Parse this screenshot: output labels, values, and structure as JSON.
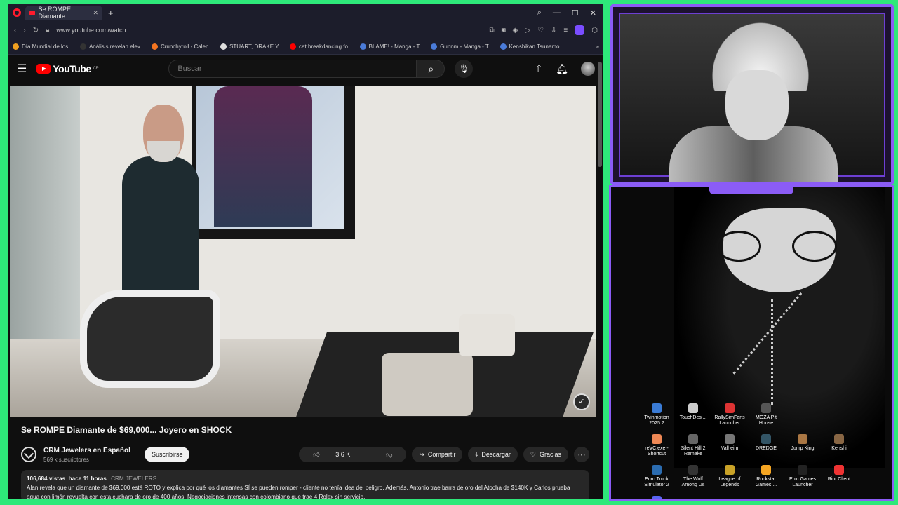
{
  "browser": {
    "tab_title": "Se ROMPE Diamante",
    "url": "www.youtube.com/watch",
    "bookmarks": [
      {
        "label": "Día Mundial de los...",
        "color": "#f0a020"
      },
      {
        "label": "Análisis revelan elev...",
        "color": "#333333"
      },
      {
        "label": "Crunchyroll - Calen...",
        "color": "#f47521"
      },
      {
        "label": "STUART, DRAKE Y...",
        "color": "#dddddd"
      },
      {
        "label": "cat breakdancing fo...",
        "color": "#ff0000"
      },
      {
        "label": "BLAME! - Manga - T...",
        "color": "#4a7bd8"
      },
      {
        "label": "Gunnm - Manga - T...",
        "color": "#4a7bd8"
      },
      {
        "label": "Kenshikan Tsunemo...",
        "color": "#4a7bd8"
      }
    ]
  },
  "youtube": {
    "logo_text": "YouTube",
    "country": "CR",
    "search_placeholder": "Buscar"
  },
  "video": {
    "title": "Se ROMPE Diamante de $69,000... Joyero en SHOCK",
    "channel_name": "CRM Jewelers en Español",
    "subscribers": "569 k suscriptores",
    "subscribe_label": "Suscribirse",
    "likes": "3.6 K",
    "share_label": "Compartir",
    "download_label": "Descargar",
    "thanks_label": "Gracias",
    "views": "106,684 vistas",
    "posted": "hace 11 horas",
    "channel_tag": "CRM JEWELERS",
    "description": "Alan revela que un diamante de $69,000 está ROTO y explica por qué los diamantes SÍ se pueden romper - cliente no tenía idea del peligro. Además, Antonio trae barra de oro del Atocha de $140K y Carlos prueba agua con limón revuelta con esta cuchara de oro de 400 años. Negociaciones intensas con colombiano que trae 4 Rolex sin servicio."
  },
  "desktop_icons": [
    {
      "label": "Twinmotion 2025.2",
      "color": "#3a7bd5"
    },
    {
      "label": "TouchDesi...",
      "color": "#cccccc"
    },
    {
      "label": "RallySimFans Launcher",
      "color": "#d33"
    },
    {
      "label": "MOZA Pit House",
      "color": "#555555"
    },
    {
      "label": "",
      "color": "transparent"
    },
    {
      "label": "",
      "color": "transparent"
    },
    {
      "label": "reVC.exe - Shortcut",
      "color": "#e85"
    },
    {
      "label": "Silent Hill 2 Remake",
      "color": "#666666"
    },
    {
      "label": "Valheim",
      "color": "#777777"
    },
    {
      "label": "DREDGE",
      "color": "#335566"
    },
    {
      "label": "Jump King",
      "color": "#aa7744"
    },
    {
      "label": "Kenshi",
      "color": "#886644"
    },
    {
      "label": "Euro Truck Simulator 2",
      "color": "#2b6cb0"
    },
    {
      "label": "The Wolf Among Us",
      "color": "#333333"
    },
    {
      "label": "League of Legends",
      "color": "#c9a227"
    },
    {
      "label": "Rockstar Games ...",
      "color": "#f5a623"
    },
    {
      "label": "Epic Games Launcher",
      "color": "#222222"
    },
    {
      "label": "Riot Client",
      "color": "#e33"
    },
    {
      "label": "Discord",
      "color": "#5865f2"
    }
  ]
}
